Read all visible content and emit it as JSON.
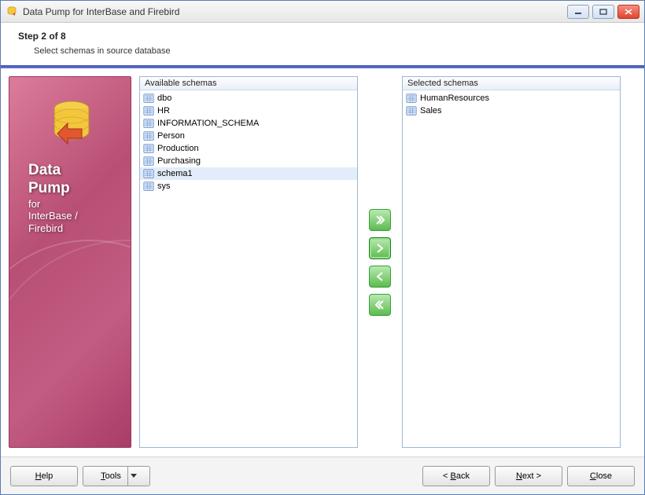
{
  "window": {
    "title": "Data Pump for InterBase and Firebird"
  },
  "header": {
    "step_title": "Step 2 of 8",
    "subtitle": "Select schemas in source database"
  },
  "sidebar": {
    "line1": "Data",
    "line2": "Pump",
    "line3": "for",
    "line4": "InterBase /",
    "line5": "Firebird"
  },
  "panels": {
    "available_label": "Available schemas",
    "selected_label": "Selected schemas",
    "available": [
      {
        "name": "dbo"
      },
      {
        "name": "HR"
      },
      {
        "name": "INFORMATION_SCHEMA"
      },
      {
        "name": "Person"
      },
      {
        "name": "Production"
      },
      {
        "name": "Purchasing"
      },
      {
        "name": "schema1",
        "selected": true
      },
      {
        "name": "sys"
      }
    ],
    "selected": [
      {
        "name": "HumanResources"
      },
      {
        "name": "Sales"
      }
    ]
  },
  "footer": {
    "help": "Help",
    "tools": "Tools",
    "back": "< Back",
    "next": "Next >",
    "close": "Close"
  }
}
